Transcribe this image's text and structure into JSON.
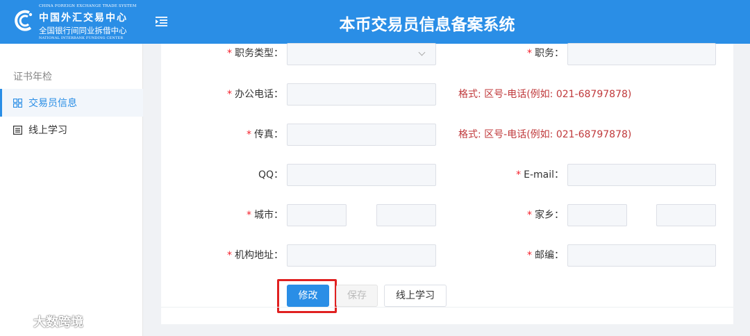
{
  "header": {
    "logo": {
      "en_top": "CHINA FOREIGN EXCHANGE TRADE SYSTEM",
      "cn_line1": "中国外汇交易中心",
      "cn_line2": "全国银行间同业拆借中心",
      "en_bottom": "NATIONAL INTERBANK FUNDING CENTER"
    },
    "title": "本币交易员信息备案系统",
    "menu_icon": "menu-fold-icon"
  },
  "sidebar": {
    "group_label": "证书年检",
    "items": [
      {
        "label": "交易员信息",
        "icon": "grid-icon",
        "active": true
      },
      {
        "label": "线上学习",
        "icon": "list-icon",
        "active": false
      }
    ]
  },
  "form": {
    "required_mark": "*",
    "job_type": {
      "label": "职务类型：",
      "value": ""
    },
    "position": {
      "label": "职务：",
      "value": ""
    },
    "office_phone": {
      "label": "办公电话：",
      "value": "",
      "hint": "格式: 区号-电话(例如: 021-68797878)"
    },
    "fax": {
      "label": "传真：",
      "value": "",
      "hint": "格式: 区号-电话(例如: 021-68797878)"
    },
    "qq": {
      "label": "QQ：",
      "value": ""
    },
    "email": {
      "label": "E-mail：",
      "value": ""
    },
    "city": {
      "label": "城市：",
      "value1": "",
      "value2": ""
    },
    "hometown": {
      "label": "家乡：",
      "value1": "",
      "value2": ""
    },
    "address": {
      "label": "机构地址：",
      "value": ""
    },
    "zipcode": {
      "label": "邮编：",
      "value": ""
    }
  },
  "buttons": {
    "edit": "修改",
    "save": "保存",
    "online_study": "线上学习"
  },
  "colors": {
    "primary": "#2a8ee6",
    "required": "#f5222d",
    "hint": "#c0393b",
    "highlight": "#e02020"
  },
  "watermark": "大数跨境"
}
